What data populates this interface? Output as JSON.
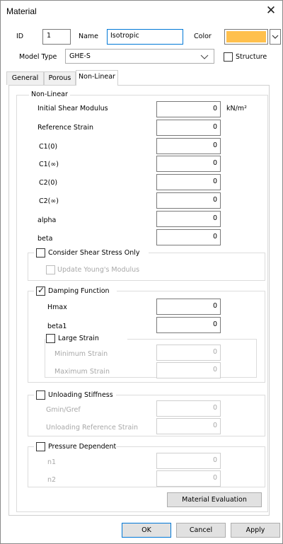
{
  "window": {
    "title": "Material"
  },
  "header": {
    "id_label": "ID",
    "id_value": "1",
    "name_label": "Name",
    "name_value": "Isotropic",
    "color_label": "Color",
    "color_value": "#FFC04D",
    "model_type_label": "Model Type",
    "model_type_value": "GHE-S",
    "structure_label": "Structure",
    "structure_checked": false
  },
  "tabs": [
    {
      "label": "General",
      "active": false
    },
    {
      "label": "Porous",
      "active": false
    },
    {
      "label": "Non-Linear",
      "active": true
    }
  ],
  "nonlinear": {
    "group_title": "Non-Linear",
    "unit": "kN/m²",
    "fields": [
      {
        "label": "Initial Shear Modulus",
        "value": "0"
      },
      {
        "label": "Reference Strain",
        "value": "0"
      },
      {
        "label": "C1(0)",
        "value": "0"
      },
      {
        "label": "C1(∞)",
        "value": "0"
      },
      {
        "label": "C2(0)",
        "value": "0"
      },
      {
        "label": "C2(∞)",
        "value": "0"
      },
      {
        "label": "alpha",
        "value": "0"
      },
      {
        "label": "beta",
        "value": "0"
      }
    ],
    "shear_stress": {
      "label": "Consider Shear Stress Only",
      "checked": false,
      "update_label": "Update Young's Modulus"
    },
    "damping": {
      "label": "Damping Function",
      "checked": true,
      "hmax_label": "Hmax",
      "hmax_value": "0",
      "beta1_label": "beta1",
      "beta1_value": "0",
      "large_strain": {
        "label": "Large Strain",
        "checked": false,
        "min_label": "Minimum Strain",
        "min_value": "0",
        "max_label": "Maximum Strain",
        "max_value": "0"
      }
    },
    "unloading": {
      "label": "Unloading Stiffness",
      "checked": false,
      "gmin_label": "Gmin/Gref",
      "gmin_value": "0",
      "refstrain_label": "Unloading Reference Strain",
      "refstrain_value": "0"
    },
    "pressure": {
      "label": "Pressure Dependent",
      "checked": false,
      "n1_label": "n1",
      "n1_value": "0",
      "n2_label": "n2",
      "n2_value": "0"
    },
    "evaluation_button": "Material Evaluation"
  },
  "footer": {
    "ok": "OK",
    "cancel": "Cancel",
    "apply": "Apply"
  },
  "icons": {
    "close": "close-icon",
    "dropdown": "chevron-down-icon",
    "check": "checkmark-icon"
  }
}
